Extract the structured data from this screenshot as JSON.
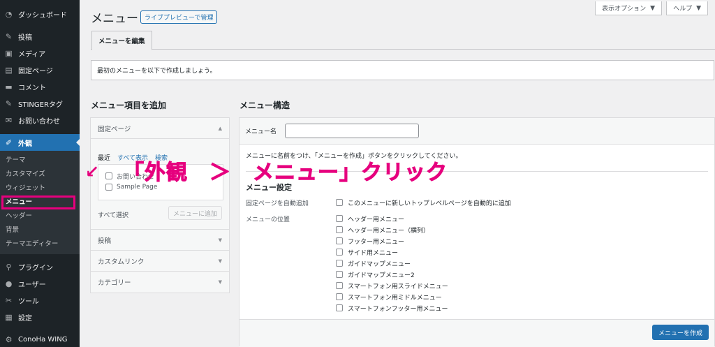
{
  "sidebar": {
    "items": [
      {
        "label": "ダッシュボード",
        "icon": "dashboard-icon"
      },
      {
        "label": "投稿",
        "icon": "pin-icon"
      },
      {
        "label": "メディア",
        "icon": "media-icon"
      },
      {
        "label": "固定ページ",
        "icon": "page-icon"
      },
      {
        "label": "コメント",
        "icon": "comment-icon"
      },
      {
        "label": "STINGERタグ",
        "icon": "pin-icon"
      },
      {
        "label": "お問い合わせ",
        "icon": "mail-icon"
      },
      {
        "label": "外観",
        "icon": "brush-icon"
      }
    ],
    "submenu": [
      "テーマ",
      "カスタマイズ",
      "ウィジェット",
      "メニュー",
      "ヘッダー",
      "背景",
      "テーマエディター"
    ],
    "bottom_items": [
      {
        "label": "プラグイン",
        "icon": "plugin-icon"
      },
      {
        "label": "ユーザー",
        "icon": "user-icon"
      },
      {
        "label": "ツール",
        "icon": "wrench-icon"
      },
      {
        "label": "設定",
        "icon": "settings-icon"
      },
      {
        "label": "ConoHa WING",
        "icon": "gear-icon"
      }
    ]
  },
  "header": {
    "title": "メニュー",
    "preview_button": "ライブプレビューで管理",
    "screen_options": "表示オプション",
    "help": "ヘルプ",
    "tab": "メニューを編集",
    "notice": "最初のメニューを以下で作成しましょう。"
  },
  "add_items": {
    "heading": "メニュー項目を追加",
    "sections": [
      "固定ページ",
      "投稿",
      "カスタムリンク",
      "カテゴリー"
    ],
    "tabs": [
      "最近",
      "すべて表示",
      "検索"
    ],
    "pages": [
      "お問い合わせ",
      "Sample Page"
    ],
    "select_all": "すべて選択",
    "add_button": "メニューに追加"
  },
  "structure": {
    "heading": "メニュー構造",
    "name_label": "メニュー名",
    "name_value": "",
    "description": "メニューに名前をつけ、「メニューを作成」ボタンをクリックしてください。",
    "settings_heading": "メニュー設定",
    "auto_add_label": "固定ページを自動追加",
    "auto_add_option": "このメニューに新しいトップレベルページを自動的に追加",
    "location_label": "メニューの位置",
    "locations": [
      "ヘッダー用メニュー",
      "ヘッダー用メニュー（横列）",
      "フッター用メニュー",
      "サイド用メニュー",
      "ガイドマップメニュー",
      "ガイドマップメニュー2",
      "スマートフォン用スライドメニュー",
      "スマートフォン用ミドルメニュー",
      "スマートフォンフッター用メニュー"
    ],
    "create_button": "メニューを作成"
  },
  "annotation": {
    "text": "「外観　＞　メニュー」クリック",
    "arrow": "↙",
    "color": "#e6007e"
  },
  "colors": {
    "accent": "#2271b1",
    "sidebar": "#1d2327",
    "highlight": "#e6007e"
  }
}
